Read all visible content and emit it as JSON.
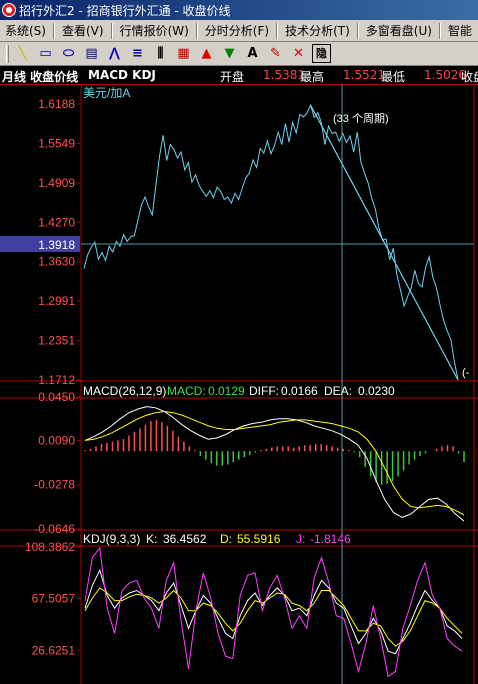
{
  "window": {
    "title": "招行外汇2 - 招商银行外汇通 - 收盘价线"
  },
  "menu": [
    "系统(S)",
    "查看(V)",
    "行情报价(W)",
    "分时分析(F)",
    "技术分析(T)",
    "多窗看盘(U)",
    "智能"
  ],
  "toolbar": [
    {
      "icon": "line-draw-icon",
      "glyph": "╲",
      "color": "#c8b400"
    },
    {
      "icon": "rectangle-draw-icon",
      "glyph": "▭",
      "color": "#0000c0"
    },
    {
      "icon": "ellipse-draw-icon",
      "glyph": "⬭",
      "color": "#0000c0"
    },
    {
      "icon": "fibonacci-icon",
      "glyph": "▤",
      "color": "#000080"
    },
    {
      "icon": "gann-fan-icon",
      "glyph": "⋀",
      "color": "#0000c0"
    },
    {
      "icon": "channel-lines-icon",
      "glyph": "≡",
      "color": "#0000c0"
    },
    {
      "icon": "parallel-lines-icon",
      "glyph": "⫼",
      "color": "#000"
    },
    {
      "icon": "grid-icon",
      "glyph": "▦",
      "color": "#c00000"
    },
    {
      "icon": "up-arrow-icon",
      "glyph": "▲",
      "color": "#e00000"
    },
    {
      "icon": "down-arrow-icon",
      "glyph": "▼",
      "color": "#008000"
    },
    {
      "icon": "text-tool-icon",
      "glyph": "A",
      "color": "#000"
    },
    {
      "icon": "eraser-icon",
      "glyph": "✎",
      "color": "#c00000"
    },
    {
      "icon": "delete-icon",
      "glyph": "✕",
      "color": "#e00000"
    },
    {
      "icon": "hide-drawings-icon",
      "glyph": "隐",
      "color": "#000"
    }
  ],
  "info": {
    "label": "月线 收盘价线",
    "indicators": "MACD KDJ",
    "open_label": "开盘",
    "open": "1.5381",
    "high_label": "最高",
    "high": "1.5521",
    "low_label": "最低",
    "low": "1.5026",
    "close_label": "收盘"
  },
  "colors": {
    "axis": "#b00000",
    "price": "#6fd2ee",
    "macd_dif": "#ffffff",
    "macd_dea": "#ffff00",
    "bar_up": "#ff5050",
    "bar_down": "#3cc83c",
    "k_line": "#ffffff",
    "d_line": "#ffff00",
    "j_line": "#ff40ff",
    "crosshair": "#4f9aa8",
    "cursor_value_bg": "#4040a0"
  },
  "chart_data": [
    {
      "type": "line",
      "name": "price",
      "legend": "美元/加A",
      "ylim": [
        1.1712,
        1.6188
      ],
      "yticks": [
        "1.6188",
        "1.5549",
        "1.4909",
        "1.4270",
        "1.3630",
        "1.2991",
        "1.2351",
        "1.1712"
      ],
      "cursor_value": "1.3918",
      "annotation": "(33 个周期)",
      "edge_label": "(-",
      "series": [
        {
          "name": "美元/加A",
          "values": [
            1.352,
            1.374,
            1.386,
            1.395,
            1.367,
            1.378,
            1.365,
            1.388,
            1.379,
            1.396,
            1.388,
            1.407,
            1.396,
            1.404,
            1.405,
            1.43,
            1.456,
            1.468,
            1.452,
            1.439,
            1.487,
            1.534,
            1.568,
            1.527,
            1.553,
            1.545,
            1.531,
            1.541,
            1.512,
            1.524,
            1.492,
            1.504,
            1.487,
            1.477,
            1.469,
            1.478,
            1.467,
            1.484,
            1.477,
            1.464,
            1.468,
            1.458,
            1.474,
            1.464,
            1.482,
            1.499,
            1.507,
            1.528,
            1.516,
            1.547,
            1.539,
            1.559,
            1.538,
            1.552,
            1.573,
            1.553,
            1.587,
            1.557,
            1.589,
            1.572,
            1.602,
            1.598,
            1.604,
            1.617,
            1.597,
            1.605,
            1.589,
            1.553,
            1.583,
            1.571,
            1.573,
            1.558,
            1.571,
            1.556,
            1.567,
            1.541,
            1.573,
            1.525,
            1.507,
            1.491,
            1.466,
            1.449,
            1.418,
            1.398,
            1.4,
            1.366,
            1.385,
            1.342,
            1.317,
            1.291,
            1.307,
            1.321,
            1.349,
            1.328,
            1.322,
            1.354,
            1.371,
            1.338,
            1.321,
            1.293,
            1.268,
            1.251,
            1.237,
            1.201,
            1.1712
          ]
        }
      ]
    },
    {
      "type": "bar",
      "name": "macd",
      "legend": {
        "label": "MACD(26,12,9)",
        "macd_label": "MACD:",
        "macd": "0.0129",
        "diff_label": "DIFF:",
        "diff": "0.0166",
        "dea_label": "DEA:",
        "dea": "0.0230"
      },
      "ylim": [
        -0.0646,
        0.045
      ],
      "yticks": [
        "0.0450",
        "0.0090",
        "-0.0278",
        "-0.0646"
      ],
      "series": [
        {
          "name": "MACD",
          "values": [
            0.001,
            0.002,
            0.004,
            0.006,
            0.007,
            0.008,
            0.009,
            0.01,
            0.013,
            0.016,
            0.019,
            0.022,
            0.025,
            0.026,
            0.024,
            0.021,
            0.017,
            0.012,
            0.008,
            0.004,
            0.001,
            -0.004,
            -0.007,
            -0.01,
            -0.012,
            -0.012,
            -0.011,
            -0.009,
            -0.007,
            -0.005,
            -0.003,
            -0.001,
            0.001,
            0.002,
            0.003,
            0.004,
            0.004,
            0.004,
            0.003,
            0.004,
            0.005,
            0.005,
            0.006,
            0.006,
            0.005,
            0.004,
            0.003,
            0.002,
            0.001,
            -0.001,
            -0.005,
            -0.013,
            -0.021,
            -0.026,
            -0.028,
            -0.027,
            -0.025,
            -0.021,
            -0.016,
            -0.011,
            -0.007,
            -0.004,
            -0.002,
            0.0,
            0.002,
            0.004,
            0.005,
            0.004,
            -0.002,
            -0.009
          ]
        },
        {
          "name": "DIFF",
          "values": [
            0.009,
            0.012,
            0.016,
            0.021,
            0.027,
            0.032,
            0.035,
            0.037,
            0.036,
            0.033,
            0.028,
            0.022,
            0.017,
            0.013,
            0.01,
            0.011,
            0.014,
            0.018,
            0.021,
            0.023,
            0.024,
            0.026,
            0.027,
            0.027,
            0.026,
            0.024,
            0.021,
            0.019,
            0.017,
            0.014,
            0.01,
            0.005,
            -0.006,
            -0.024,
            -0.04,
            -0.051,
            -0.055,
            -0.052,
            -0.046,
            -0.04,
            -0.039,
            -0.044,
            -0.052,
            -0.058
          ]
        },
        {
          "name": "DEA",
          "values": [
            0.009,
            0.01,
            0.012,
            0.015,
            0.019,
            0.023,
            0.027,
            0.03,
            0.032,
            0.033,
            0.032,
            0.03,
            0.027,
            0.024,
            0.021,
            0.019,
            0.018,
            0.018,
            0.019,
            0.02,
            0.021,
            0.022,
            0.024,
            0.025,
            0.026,
            0.026,
            0.025,
            0.024,
            0.023,
            0.021,
            0.019,
            0.016,
            0.01,
            0.0,
            -0.014,
            -0.029,
            -0.04,
            -0.046,
            -0.047,
            -0.046,
            -0.045,
            -0.046,
            -0.049,
            -0.053
          ]
        }
      ]
    },
    {
      "type": "line",
      "name": "kdj",
      "legend": {
        "label": "KDJ(9,3,3)",
        "k_label": "K:",
        "k": "36.4562",
        "d_label": "D:",
        "d": "55.5916",
        "j_label": "J:",
        "j": "-1.8146"
      },
      "ylim": [
        0,
        108.3862
      ],
      "yticks": [
        "108.3862",
        "67.5057",
        "26.6251"
      ],
      "series": [
        {
          "name": "K",
          "values": [
            60,
            78,
            90,
            70,
            60,
            68,
            72,
            74,
            70,
            66,
            58,
            72,
            80,
            62,
            44,
            58,
            70,
            64,
            52,
            40,
            36,
            54,
            66,
            72,
            62,
            70,
            76,
            70,
            58,
            60,
            54,
            70,
            82,
            76,
            64,
            60,
            46,
            32,
            40,
            52,
            42,
            26,
            24,
            36,
            48,
            62,
            74,
            66,
            60,
            46,
            42,
            36
          ]
        },
        {
          "name": "D",
          "values": [
            58,
            68,
            76,
            72,
            66,
            66,
            69,
            71,
            70,
            68,
            64,
            68,
            74,
            68,
            58,
            58,
            64,
            62,
            56,
            48,
            42,
            48,
            58,
            66,
            64,
            68,
            72,
            71,
            64,
            62,
            58,
            64,
            74,
            74,
            68,
            62,
            52,
            42,
            42,
            48,
            46,
            36,
            30,
            34,
            42,
            54,
            66,
            64,
            60,
            52,
            46,
            40
          ]
        },
        {
          "name": "J",
          "values": [
            66,
            100,
            112,
            60,
            40,
            74,
            80,
            82,
            68,
            60,
            44,
            82,
            96,
            50,
            12,
            58,
            88,
            68,
            40,
            22,
            20,
            70,
            86,
            88,
            58,
            76,
            86,
            68,
            44,
            54,
            44,
            84,
            100,
            80,
            54,
            52,
            32,
            10,
            32,
            62,
            36,
            6,
            10,
            44,
            62,
            82,
            96,
            70,
            60,
            36,
            30,
            26
          ]
        }
      ]
    }
  ]
}
